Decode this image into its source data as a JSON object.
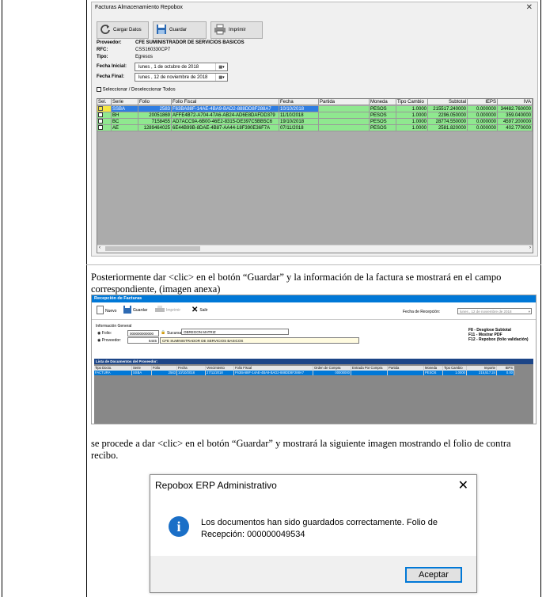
{
  "win1": {
    "title": "Facturas Almacenamiento Repobox",
    "close": "✕",
    "buttons": {
      "cargar": "Cargar Datos",
      "guardar": "Guardar",
      "imprimir": "Imprimir"
    },
    "labels": {
      "proveedor": "Proveedor:",
      "rfc": "RFC:",
      "tipo": "Tipo:",
      "fecha_inicial": "Fecha Inicial:",
      "fecha_final": "Fecha Final:"
    },
    "values": {
      "proveedor": "CFE SUMINISTRADOR DE SERVICIOS BASICOS",
      "rfc": "CSS160330CP7",
      "tipo": "Egresos"
    },
    "fecha_inicial": "lunes   ,   1 de   octubre   de 2018",
    "fecha_final": "lunes   , 12 de noviembre de 2018",
    "select_all": "Seleccionar / Deseleccionar Todos",
    "columns": [
      "Sel.",
      "Serie",
      "Folio",
      "Folio Fiscal",
      "Fecha",
      "Partida",
      "Moneda",
      "Tipo Cambio",
      "Subtotal",
      "IEPS",
      "IVA"
    ],
    "rows": [
      [
        "",
        "SSBA",
        "2583",
        "F63BA88F-14AE-4BA9-BAD2-888DD8F288A7",
        "10/10/2018",
        "",
        "PESOS",
        "1.0000",
        "215517.240000",
        "0.000000",
        "34482.760000"
      ],
      [
        "",
        "BH",
        "20051869",
        "AFFE4B72-A704-47A6-AB24-AD6E8DAFDD379",
        "11/10/2018",
        "",
        "PESOS",
        "1.0000",
        "2296.050000",
        "0.000000",
        "359.040000"
      ],
      [
        "",
        "BC",
        "7158455",
        "AD7ACC9A-6B00-46E2-8315-DE397C5BB5C6",
        "19/10/2018",
        "",
        "PESOS",
        "1.0000",
        "28774.550000",
        "0.000000",
        "4597.200000"
      ],
      [
        "",
        "AE",
        "1289464025",
        "6E44B99B-8DAE-4B87-AA44-18F390E36F7A",
        "07/11/2018",
        "",
        "PESOS",
        "1.0000",
        "2581.820000",
        "0.000000",
        "402.770000"
      ]
    ]
  },
  "para1": "Posteriormente dar <clic> en el botón “Guardar” y la información de la factura se mostrará en el campo correspondiente, (imagen anexa)",
  "win2": {
    "title": "Recepción de Facturas",
    "toolbar": {
      "nuevo": "Nuevo",
      "guardar": "Guardar",
      "imprimir": "Imprimir",
      "salir": "Salir"
    },
    "fecha_label": "Fecha de Recepción:",
    "fecha_value": "lunes   , 12 de noviembre de 2018",
    "info_general": "Información General",
    "folio_label": "Folio:",
    "folio_value": "000000000000",
    "sucursal_label": "Sucursal",
    "sucursal_value": "OBREGON MATRIZ",
    "proveedor_label": "Proveedor:",
    "proveedor_id": "6445",
    "proveedor_value": "CFE SUMINISTRADOR DE SERVICIOS BASICOS",
    "hints": [
      "F8 - Desglose Subtotal",
      "F11 - Mostrar PDF",
      "F12 - Repobox (folio validación)"
    ],
    "lista_title": "Lista de Documentos del Proveedor:",
    "columns": [
      "Tipo Docto.",
      "Serie",
      "Folio",
      "Fecha",
      "Vencimiento",
      "Folio Fiscal",
      "Orden de Compra",
      "Entrada Por Compra",
      "Partida",
      "Moneda",
      "Tipo Cambio",
      "Importe",
      "IEPS"
    ],
    "row": [
      "FACTURA",
      "SSBA",
      "2583",
      "10/10/2018",
      "27/11/2018",
      "F63BA88F-14AE-4BA9-BAD2-888DD8F288A7",
      "00000000",
      "",
      "",
      "PESOS",
      "1.0000",
      "215,517.24",
      "0.00"
    ]
  },
  "para2": "se procede a dar <clic> en el botón “Guardar” y mostrará la siguiente imagen mostrando el folio de contra recibo.",
  "dialog": {
    "title": "Repobox ERP Administrativo",
    "close": "✕",
    "icon": "i",
    "message_line1": "Los documentos han sido guardados correctamente. Folio de",
    "message_line2": "Recepción: 000000049534",
    "ok": "Aceptar"
  }
}
